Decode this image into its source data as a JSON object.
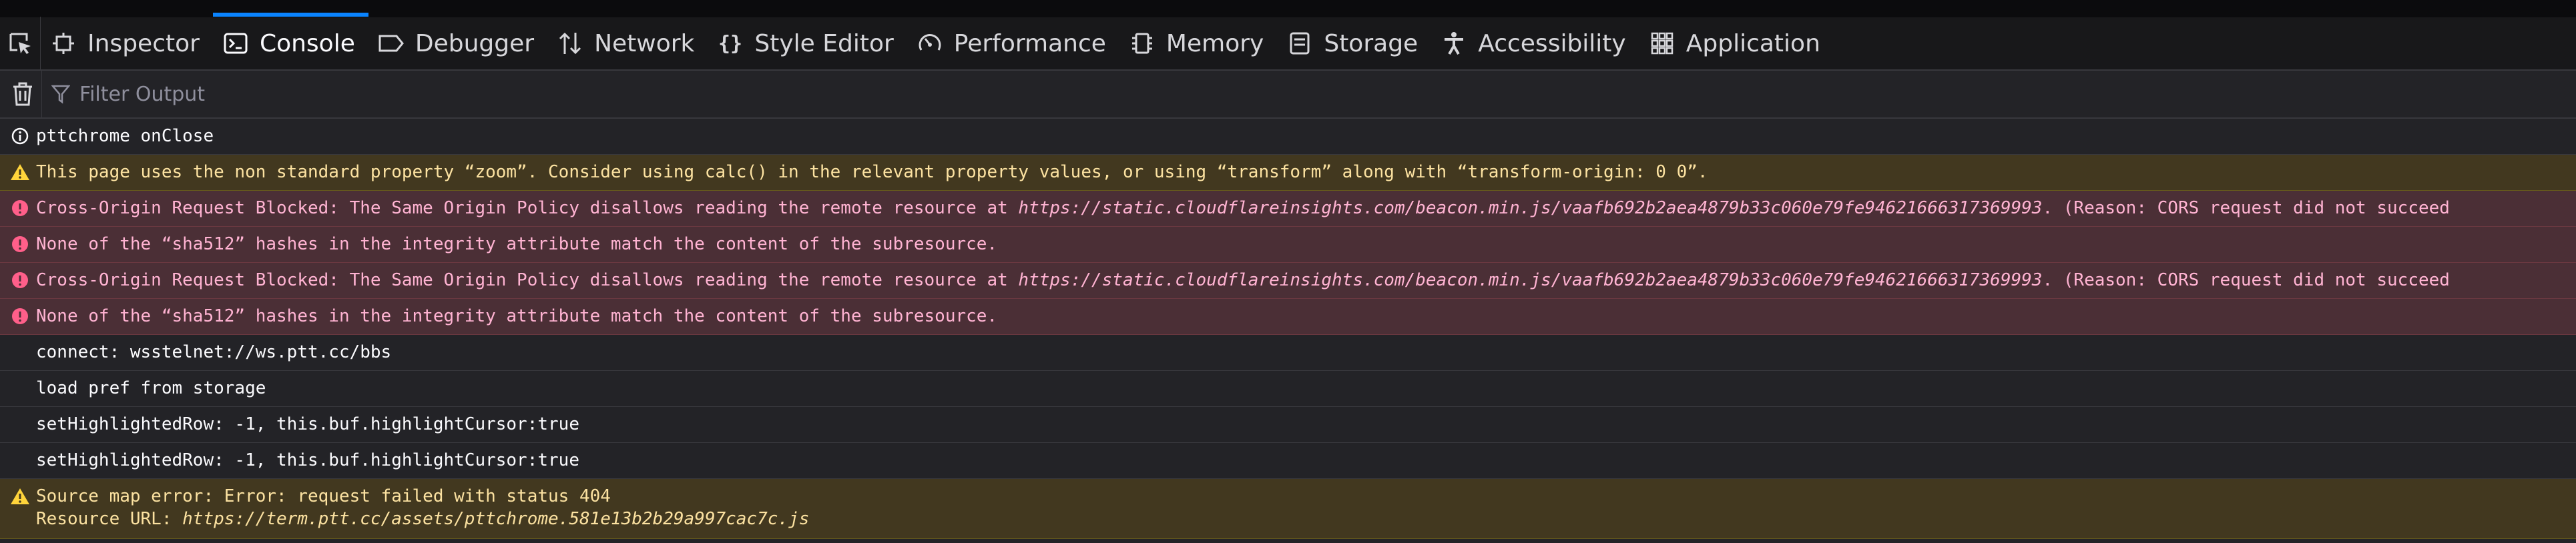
{
  "toolbar": {
    "tabs": [
      {
        "label": "Inspector",
        "icon": "inspector-icon",
        "selected": false
      },
      {
        "label": "Console",
        "icon": "console-icon",
        "selected": true
      },
      {
        "label": "Debugger",
        "icon": "debugger-icon",
        "selected": false
      },
      {
        "label": "Network",
        "icon": "network-icon",
        "selected": false
      },
      {
        "label": "Style Editor",
        "icon": "style-editor-icon",
        "selected": false
      },
      {
        "label": "Performance",
        "icon": "performance-icon",
        "selected": false
      },
      {
        "label": "Memory",
        "icon": "memory-icon",
        "selected": false
      },
      {
        "label": "Storage",
        "icon": "storage-icon",
        "selected": false
      },
      {
        "label": "Accessibility",
        "icon": "accessibility-icon",
        "selected": false
      },
      {
        "label": "Application",
        "icon": "application-icon",
        "selected": false
      }
    ]
  },
  "filter": {
    "placeholder": "Filter Output",
    "value": ""
  },
  "messages": [
    {
      "level": "info",
      "text": "pttchrome onClose"
    },
    {
      "level": "warn",
      "text": "This page uses the non standard property “zoom”. Consider using calc() in the relevant property values, or using “transform” along with “transform-origin: 0 0”."
    },
    {
      "level": "error",
      "prefix": "Cross-Origin Request Blocked: The Same Origin Policy disallows reading the remote resource at ",
      "url": "https://static.cloudflareinsights.com/beacon.min.js/vaafb692b2aea4879b33c060e79fe94621666317369993",
      "suffix": ". (Reason: CORS request did not succeed"
    },
    {
      "level": "error",
      "text": "None of the “sha512” hashes in the integrity attribute match the content of the subresource."
    },
    {
      "level": "error",
      "prefix": "Cross-Origin Request Blocked: The Same Origin Policy disallows reading the remote resource at ",
      "url": "https://static.cloudflareinsights.com/beacon.min.js/vaafb692b2aea4879b33c060e79fe94621666317369993",
      "suffix": ". (Reason: CORS request did not succeed"
    },
    {
      "level": "error",
      "text": "None of the “sha512” hashes in the integrity attribute match the content of the subresource."
    },
    {
      "level": "log",
      "text": "connect: wsstelnet://ws.ptt.cc/bbs"
    },
    {
      "level": "log",
      "text": "load pref from storage"
    },
    {
      "level": "log",
      "text": "setHighlightedRow: -1, this.buf.highlightCursor:true"
    },
    {
      "level": "log",
      "text": "setHighlightedRow: -1, this.buf.highlightCursor:true"
    },
    {
      "level": "warn",
      "line1": "Source map error: Error: request failed with status 404",
      "line2_prefix": "Resource URL: ",
      "line2_url": "https://term.ptt.cc/assets/pttchrome.581e13b2b29a997cac7c.js"
    }
  ],
  "colors": {
    "accent": "#0a84ff",
    "warn_icon": "#ffd43b",
    "error_icon": "#ff5f8a"
  }
}
